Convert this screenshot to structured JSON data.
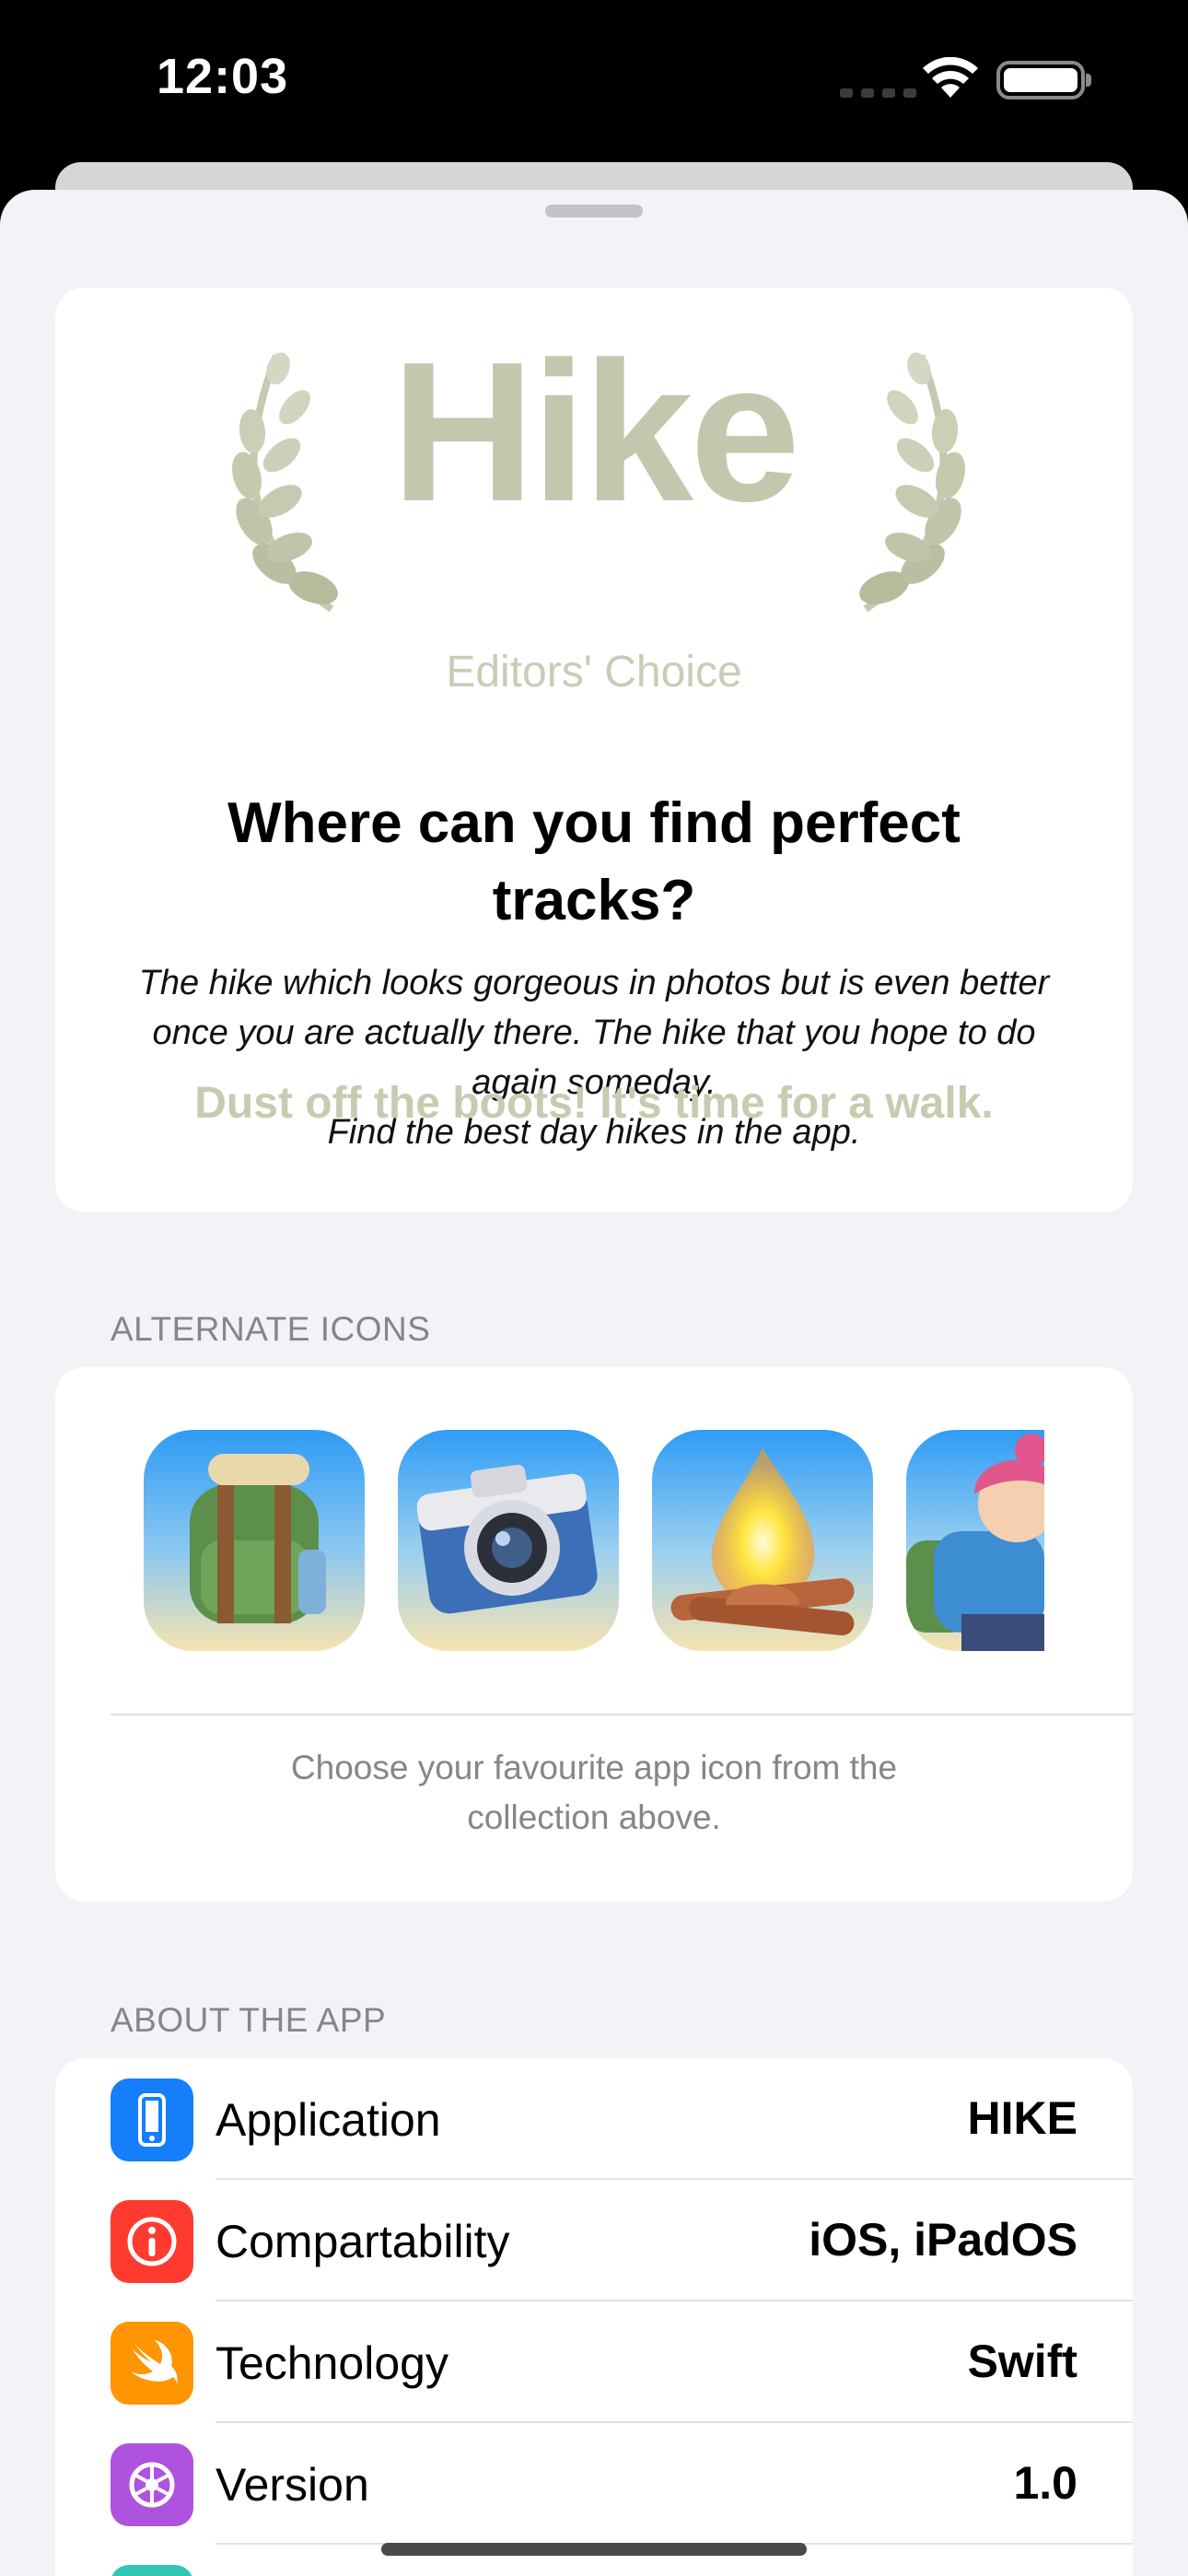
{
  "status_bar": {
    "time": "12:03"
  },
  "hero": {
    "logo_text": "Hike",
    "logo_subtitle": "Editors' Choice",
    "title": "Where can you find perfect tracks?",
    "description": "The hike which looks gorgeous in photos but is even better once you are actually there. The hike that you hope to do again someday.\nFind the best day hikes in the app.",
    "tagline": "Dust off the boots! It's time for a walk."
  },
  "alternate_icons": {
    "header": "ALTERNATE ICONS",
    "icons": [
      "backpack-icon",
      "camera-icon",
      "campfire-icon",
      "hiker-icon"
    ],
    "footer": "Choose your favourite app  icon from the collection above."
  },
  "about": {
    "header": "ABOUT THE APP",
    "rows": [
      {
        "label": "Application",
        "value": "HIKE",
        "icon": "phone-icon",
        "color": "#147efb"
      },
      {
        "label": "Compartability",
        "value": "iOS, iPadOS",
        "icon": "info-icon",
        "color": "#ff3b30"
      },
      {
        "label": "Technology",
        "value": "Swift",
        "icon": "swift-icon",
        "color": "#ff9500"
      },
      {
        "label": "Version",
        "value": "1.0",
        "icon": "gear-icon",
        "color": "#af52de"
      }
    ]
  },
  "colors": {
    "accent_green": "#c2c8ad",
    "background": "#f2f2f7"
  }
}
